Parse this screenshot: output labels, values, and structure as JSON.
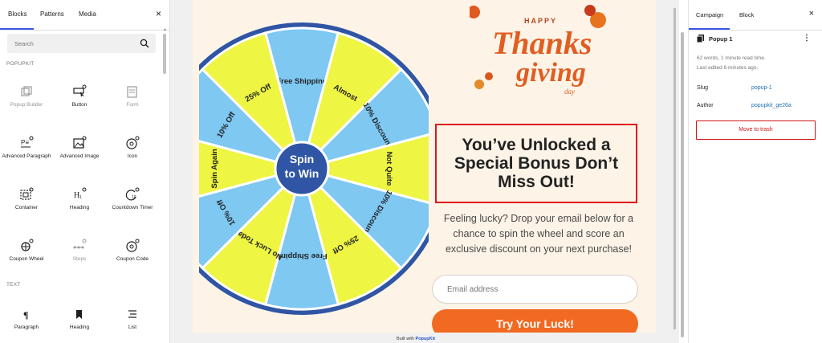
{
  "left_panel": {
    "tabs": [
      "Blocks",
      "Patterns",
      "Media"
    ],
    "close": "×",
    "search_placeholder": "Search",
    "section_popupkit": "POPUPKIT",
    "section_text": "TEXT",
    "popupkit_blocks": [
      {
        "label": "Popup Builder",
        "icon": "popup-builder-icon",
        "disabled": true
      },
      {
        "label": "Button",
        "icon": "button-icon",
        "disabled": false
      },
      {
        "label": "Form",
        "icon": "form-icon",
        "disabled": true
      },
      {
        "label": "Advanced Paragraph",
        "icon": "advanced-paragraph-icon",
        "disabled": false
      },
      {
        "label": "Advanced Image",
        "icon": "advanced-image-icon",
        "disabled": false
      },
      {
        "label": "Icon",
        "icon": "icon-block-icon",
        "disabled": false
      },
      {
        "label": "Container",
        "icon": "container-icon",
        "disabled": false
      },
      {
        "label": "Heading",
        "icon": "heading-icon",
        "disabled": false
      },
      {
        "label": "Countdown Timer",
        "icon": "countdown-timer-icon",
        "disabled": false
      },
      {
        "label": "Coupon Wheel",
        "icon": "coupon-wheel-icon",
        "disabled": false
      },
      {
        "label": "Steps",
        "icon": "steps-icon",
        "disabled": true
      },
      {
        "label": "Coupon Code",
        "icon": "coupon-code-icon",
        "disabled": false
      }
    ],
    "text_blocks": [
      {
        "label": "Paragraph",
        "icon": "paragraph-icon"
      },
      {
        "label": "Heading",
        "icon": "bookmark-heading-icon"
      },
      {
        "label": "List",
        "icon": "list-icon"
      }
    ]
  },
  "popup": {
    "wheel_center": "Spin to Win",
    "wheel_segments": [
      "Free Shipping",
      "Almost",
      "10% Discount",
      "Not Quite",
      "10% Discount",
      "25% Off",
      "Free Shipping",
      "No Luck Today",
      "10% Off",
      "Spin Again",
      "10% Off",
      "25% Off"
    ],
    "thanks_small": "HAPPY",
    "thanks_main": "Thanks",
    "giving": "giving",
    "day": "day",
    "headline": "You’ve Unlocked a Special Bonus Don’t Miss Out!",
    "subtext": "Feeling lucky? Drop your email below for a chance to spin the wheel and score an exclusive discount on your next purchase!",
    "email_placeholder": "Email address",
    "cta": "Try Your Luck!",
    "built_with": "Built with",
    "brand": "PopupKit"
  },
  "right_panel": {
    "tabs": [
      "Campaign",
      "Block"
    ],
    "close": "×",
    "title": "Popup 1",
    "kebab": "⋮",
    "meta_line1": "62 words, 1 minute read time.",
    "meta_line2": "Last edited 6 minutes ago.",
    "slug_label": "Slug",
    "slug_value": "popup-1",
    "author_label": "Author",
    "author_value": "popupkit_ge26a",
    "trash_label": "Move to trash"
  },
  "colors": {
    "accent": "#3858e9",
    "wheel_yellow": "#eef542",
    "wheel_blue": "#7ec8f2",
    "wheel_rim": "#2f55a4",
    "cta": "#f26a21",
    "danger": "#cc1818"
  }
}
